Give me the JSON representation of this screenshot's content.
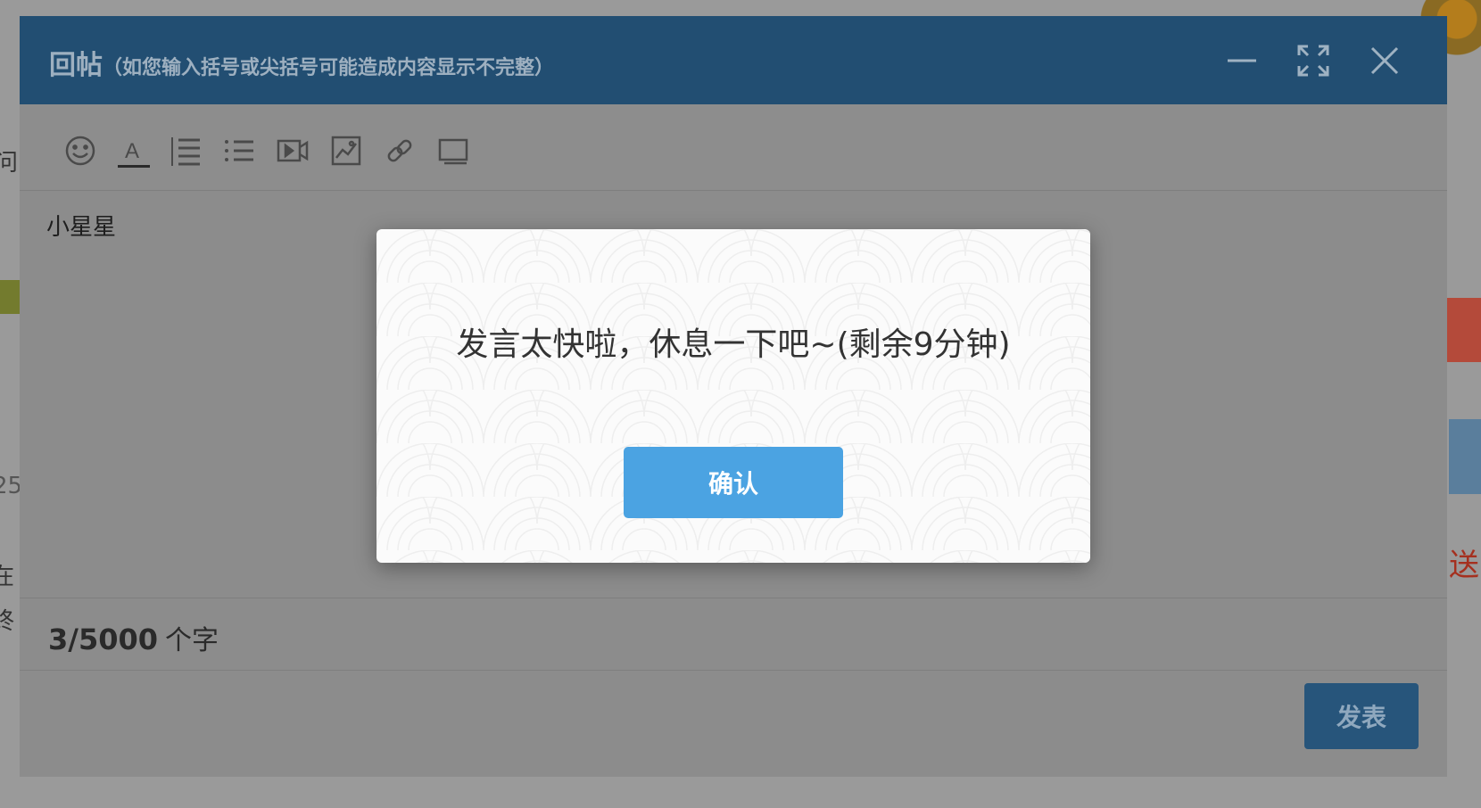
{
  "background": {
    "left_fragments": [
      "问",
      "25",
      "在",
      "终"
    ],
    "right_fragment_text": "送"
  },
  "reply_window": {
    "title": "回帖",
    "subtitle": "（如您输入括号或尖括号可能造成内容显示不完整）",
    "controls": [
      "minimize-icon",
      "fullscreen-icon",
      "close-icon"
    ],
    "toolbar": [
      "emoji-icon",
      "text-color-icon",
      "ordered-list-icon",
      "unordered-list-icon",
      "video-icon",
      "image-icon",
      "link-icon",
      "folder-icon"
    ],
    "editor_content": "小星星",
    "char_count": "3/5000",
    "char_unit": "个字",
    "submit_label": "发表"
  },
  "modal": {
    "message": "发言太快啦，休息一下吧~(剩余9分钟)",
    "confirm_label": "确认"
  },
  "colors": {
    "header": "#224e72",
    "confirm": "#4ba3e2",
    "submit": "#27557b"
  }
}
